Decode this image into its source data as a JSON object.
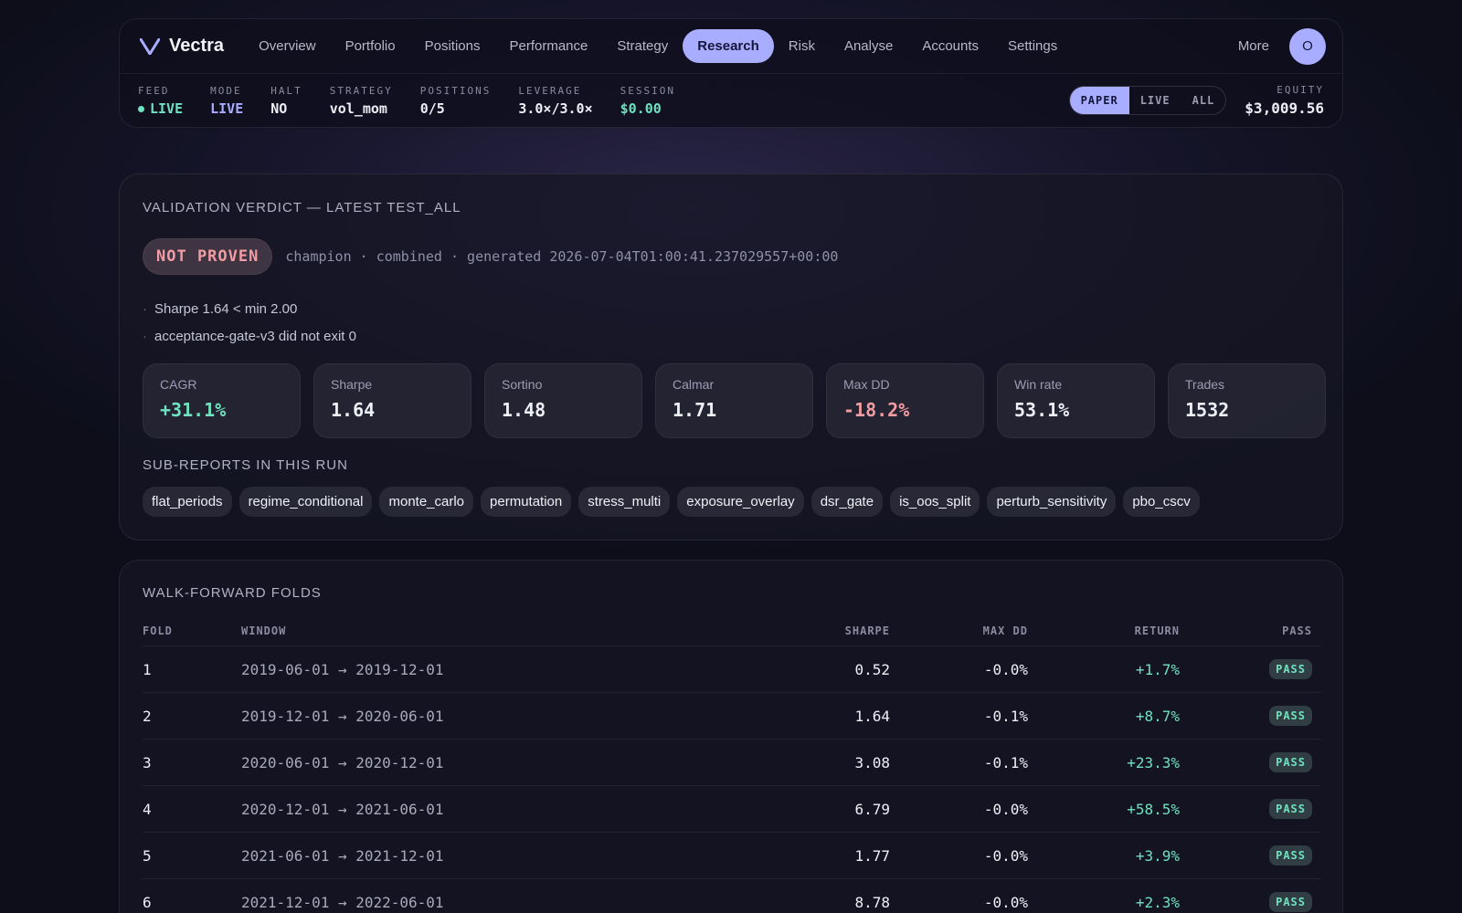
{
  "brand": {
    "name": "Vectra"
  },
  "nav": {
    "items": [
      "Overview",
      "Portfolio",
      "Positions",
      "Performance",
      "Strategy",
      "Research",
      "Risk",
      "Analyse",
      "Accounts",
      "Settings"
    ],
    "active": "Research",
    "more": "More",
    "avatar_initial": "O"
  },
  "status": {
    "feed": {
      "label": "FEED",
      "value": "LIVE"
    },
    "mode": {
      "label": "MODE",
      "value": "LIVE"
    },
    "halt": {
      "label": "HALT",
      "value": "NO"
    },
    "strategy": {
      "label": "STRATEGY",
      "value": "vol_mom"
    },
    "positions": {
      "label": "POSITIONS",
      "value": "0/5"
    },
    "leverage": {
      "label": "LEVERAGE",
      "value": "3.0×/3.0×"
    },
    "session": {
      "label": "SESSION",
      "value": "$0.00"
    },
    "segment": {
      "options": [
        "PAPER",
        "LIVE",
        "ALL"
      ],
      "selected": "PAPER"
    },
    "equity": {
      "label": "EQUITY",
      "value": "$3,009.56"
    }
  },
  "verdict": {
    "title": "VALIDATION VERDICT — LATEST TEST_ALL",
    "badge": "NOT PROVEN",
    "meta": "champion · combined · generated 2026-07-04T01:00:41.237029557+00:00",
    "reasons": [
      "Sharpe 1.64 < min 2.00",
      "acceptance-gate-v3 did not exit 0"
    ],
    "metrics": [
      {
        "label": "CAGR",
        "value": "+31.1%",
        "tone": "green"
      },
      {
        "label": "Sharpe",
        "value": "1.64",
        "tone": "neutral"
      },
      {
        "label": "Sortino",
        "value": "1.48",
        "tone": "neutral"
      },
      {
        "label": "Calmar",
        "value": "1.71",
        "tone": "neutral"
      },
      {
        "label": "Max DD",
        "value": "-18.2%",
        "tone": "red"
      },
      {
        "label": "Win rate",
        "value": "53.1%",
        "tone": "neutral"
      },
      {
        "label": "Trades",
        "value": "1532",
        "tone": "neutral"
      }
    ],
    "subreports_title": "SUB-REPORTS IN THIS RUN",
    "subreports": [
      "flat_periods",
      "regime_conditional",
      "monte_carlo",
      "permutation",
      "stress_multi",
      "exposure_overlay",
      "dsr_gate",
      "is_oos_split",
      "perturb_sensitivity",
      "pbo_cscv"
    ]
  },
  "folds": {
    "title": "WALK-FORWARD FOLDS",
    "columns": [
      "FOLD",
      "WINDOW",
      "SHARPE",
      "MAX DD",
      "RETURN",
      "PASS"
    ],
    "rows": [
      {
        "fold": "1",
        "window": "2019-06-01 → 2019-12-01",
        "sharpe": "0.52",
        "maxdd": "-0.0%",
        "ret": "+1.7%",
        "pass": "PASS"
      },
      {
        "fold": "2",
        "window": "2019-12-01 → 2020-06-01",
        "sharpe": "1.64",
        "maxdd": "-0.1%",
        "ret": "+8.7%",
        "pass": "PASS"
      },
      {
        "fold": "3",
        "window": "2020-06-01 → 2020-12-01",
        "sharpe": "3.08",
        "maxdd": "-0.1%",
        "ret": "+23.3%",
        "pass": "PASS"
      },
      {
        "fold": "4",
        "window": "2020-12-01 → 2021-06-01",
        "sharpe": "6.79",
        "maxdd": "-0.0%",
        "ret": "+58.5%",
        "pass": "PASS"
      },
      {
        "fold": "5",
        "window": "2021-06-01 → 2021-12-01",
        "sharpe": "1.77",
        "maxdd": "-0.0%",
        "ret": "+3.9%",
        "pass": "PASS"
      },
      {
        "fold": "6",
        "window": "2021-12-01 → 2022-06-01",
        "sharpe": "8.78",
        "maxdd": "-0.0%",
        "ret": "+2.3%",
        "pass": "PASS"
      }
    ]
  },
  "colors": {
    "accent": "#a9adff",
    "positive": "#6fe2bf",
    "negative": "#f29ca3",
    "background": "#0d0e1a"
  }
}
